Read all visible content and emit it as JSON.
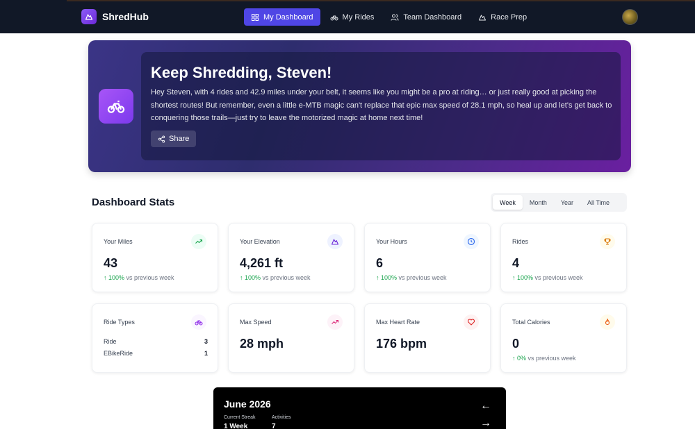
{
  "app": {
    "name": "ShredHub"
  },
  "nav": {
    "items": [
      {
        "label": "My Dashboard",
        "icon": "grid-icon",
        "active": true
      },
      {
        "label": "My Rides",
        "icon": "bike-icon",
        "active": false
      },
      {
        "label": "Team Dashboard",
        "icon": "users-icon",
        "active": false
      },
      {
        "label": "Race Prep",
        "icon": "mountain-icon",
        "active": false
      }
    ]
  },
  "hero": {
    "title": "Keep Shredding, Steven!",
    "message": "Hey Steven, with 4 rides and 42.9 miles under your belt, it seems like you might be a pro at riding… or just really good at picking the shortest routes! But remember, even a little e-MTB magic can't replace that epic max speed of 28.1 mph, so heal up and let's get back to conquering those trails—just try to leave the motorized magic at home next time!",
    "share_label": "Share"
  },
  "stats": {
    "title": "Dashboard Stats",
    "periods": [
      "Week",
      "Month",
      "Year",
      "All Time"
    ],
    "active_period": "Week",
    "cards": {
      "miles": {
        "label": "Your Miles",
        "value": "43",
        "change_arrow": "↑ 100%",
        "change_text": " vs previous week",
        "icon": "trending-up-icon"
      },
      "elevation": {
        "label": "Your Elevation",
        "value": "4,261 ft",
        "change_arrow": "↑ 100%",
        "change_text": " vs previous week",
        "icon": "mountain-icon"
      },
      "hours": {
        "label": "Your Hours",
        "value": "6",
        "change_arrow": "↑ 100%",
        "change_text": " vs previous week",
        "icon": "clock-icon"
      },
      "rides": {
        "label": "Rides",
        "value": "4",
        "change_arrow": "↑ 100%",
        "change_text": " vs previous week",
        "icon": "trophy-icon"
      },
      "ride_types": {
        "label": "Ride Types",
        "icon": "bike-icon",
        "rows": [
          {
            "name": "Ride",
            "count": "3"
          },
          {
            "name": "EBikeRide",
            "count": "1"
          }
        ]
      },
      "max_speed": {
        "label": "Max Speed",
        "value": "28 mph",
        "icon": "trending-up-icon"
      },
      "max_hr": {
        "label": "Max Heart Rate",
        "value": "176 bpm",
        "icon": "heart-icon"
      },
      "calories": {
        "label": "Total Calories",
        "value": "0",
        "change_arrow": "↑ 0%",
        "change_text": " vs previous week",
        "icon": "flame-icon"
      }
    }
  },
  "calendar": {
    "title": "June 2026",
    "prev_arrow": "←",
    "next_arrow": "→",
    "current_streak_label": "Current Streak",
    "current_streak_value": "1 Week",
    "activities_label": "Activities",
    "activities_value": "7"
  },
  "colors": {
    "nav_bg": "#111827",
    "accent": "#4f46e5",
    "positive": "#16a34a"
  }
}
